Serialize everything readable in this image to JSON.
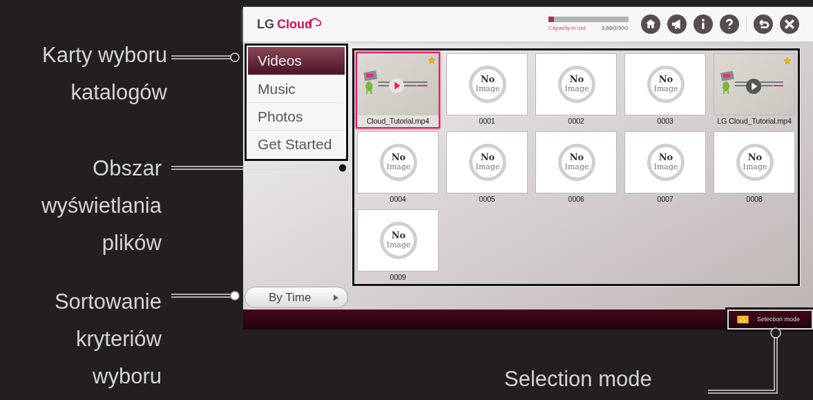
{
  "app": {
    "logo_text": "LG",
    "logo_accent": "Cloud"
  },
  "capacity": {
    "label": "Capacity in use",
    "used": "3,66G",
    "total": "/50G",
    "level": 0.07
  },
  "toolbar": [
    {
      "kind": "home"
    },
    {
      "kind": "megaphone"
    },
    {
      "kind": "info"
    },
    {
      "kind": "help"
    },
    {
      "kind": "back"
    },
    {
      "kind": "close"
    }
  ],
  "tabs": [
    {
      "label": "Videos",
      "selected": true
    },
    {
      "label": "Music",
      "selected": false
    },
    {
      "label": "Photos",
      "selected": false
    },
    {
      "label": "Get Started",
      "selected": false
    }
  ],
  "sort": {
    "label": "By Time"
  },
  "files": [
    {
      "kind": "video",
      "name": "Cloud_Tutorial.mp4",
      "selected": true,
      "starred": true
    },
    {
      "kind": "no_image",
      "name": "0001",
      "selected": false,
      "starred": false,
      "thumb_text": [
        "No",
        "Image"
      ]
    },
    {
      "kind": "no_image",
      "name": "0002",
      "selected": false,
      "starred": false,
      "thumb_text": [
        "No",
        "Image"
      ]
    },
    {
      "kind": "no_image",
      "name": "0003",
      "selected": false,
      "starred": false,
      "thumb_text": [
        "No",
        "Image"
      ]
    },
    {
      "kind": "video",
      "name": "LG Cloud_Tutorial.mp4",
      "selected": false,
      "starred": true
    },
    {
      "kind": "no_image",
      "name": "0004",
      "selected": false,
      "starred": false,
      "thumb_text": [
        "No",
        "Image"
      ]
    },
    {
      "kind": "no_image",
      "name": "0005",
      "selected": false,
      "starred": false,
      "thumb_text": [
        "No",
        "Image"
      ]
    },
    {
      "kind": "no_image",
      "name": "0006",
      "selected": false,
      "starred": false,
      "thumb_text": [
        "No",
        "Image"
      ]
    },
    {
      "kind": "no_image",
      "name": "0007",
      "selected": false,
      "starred": false,
      "thumb_text": [
        "No",
        "Image"
      ]
    },
    {
      "kind": "no_image",
      "name": "0008",
      "selected": false,
      "starred": false,
      "thumb_text": [
        "No",
        "Image"
      ]
    },
    {
      "kind": "no_image",
      "name": "0009",
      "selected": false,
      "starred": false,
      "thumb_text": [
        "No",
        "Image"
      ]
    }
  ],
  "footer": {
    "selection_button": "Selection mode"
  },
  "annotations": [
    {
      "lines": [
        "Karty wyboru",
        "katalogów"
      ]
    },
    {
      "lines": [
        "Obszar",
        "wyświetlania",
        "plików"
      ]
    },
    {
      "lines": [
        "Sortowanie",
        "kryteriów",
        "wyboru"
      ]
    }
  ],
  "selection_annotation": "Selection mode"
}
